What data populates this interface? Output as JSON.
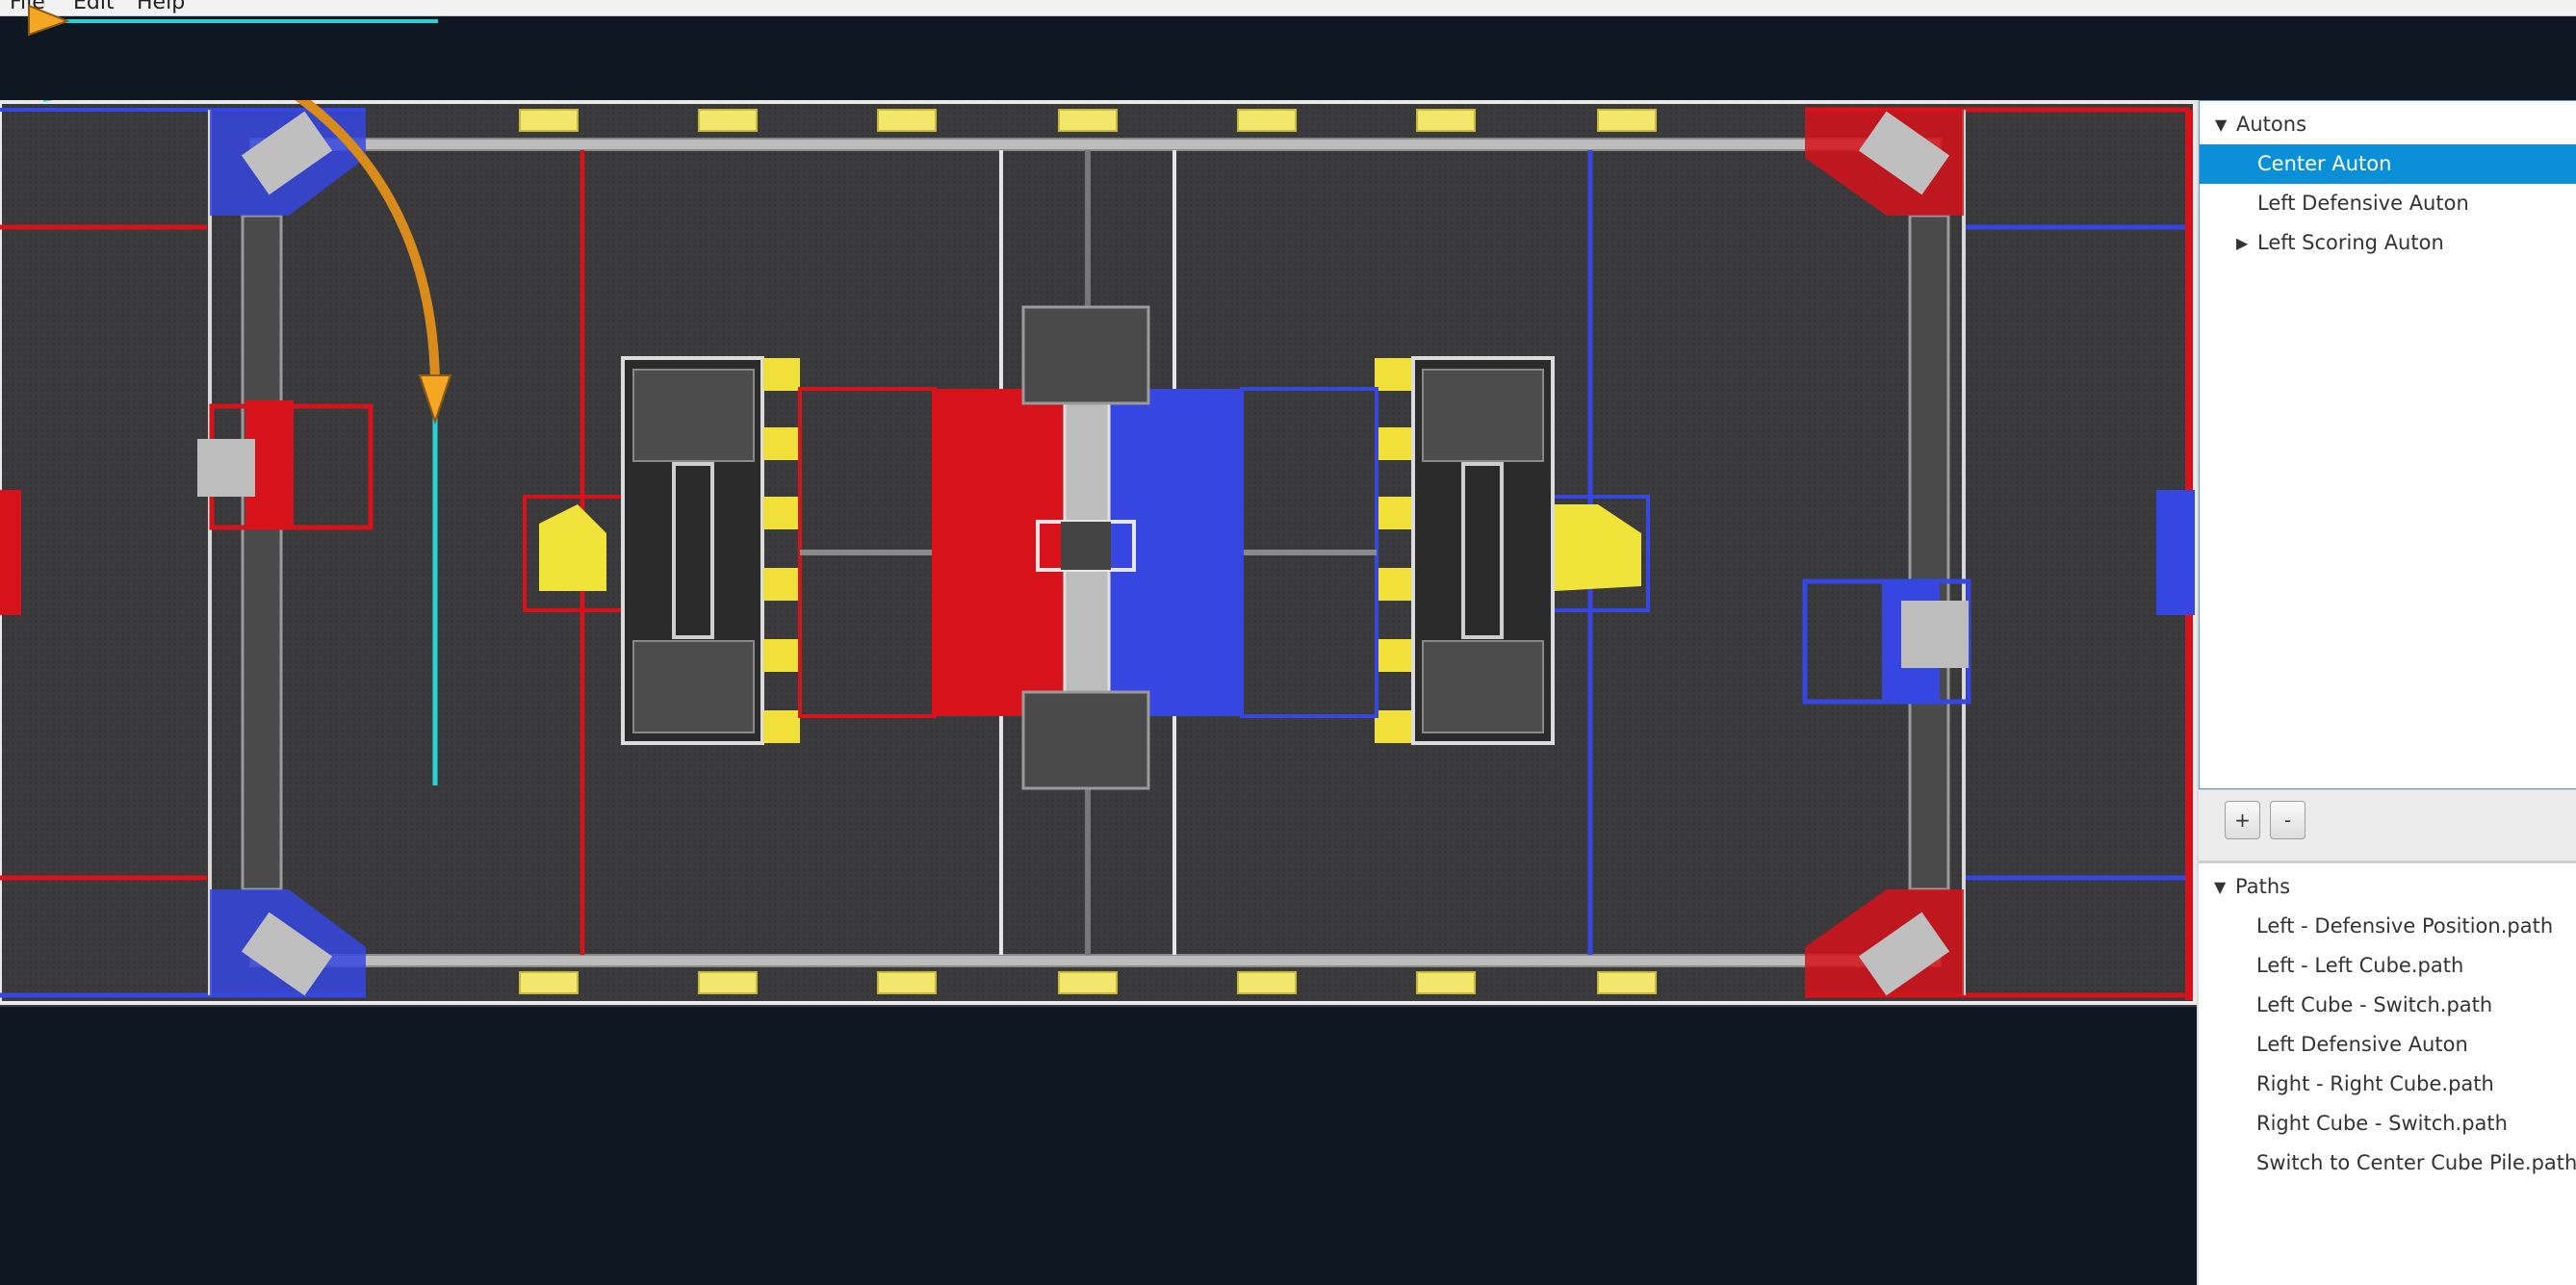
{
  "menu": {
    "file": "File",
    "edit": "Edit",
    "help": "Help"
  },
  "autons_tree": {
    "root_label": "Autons",
    "items": [
      {
        "label": "Center Auton",
        "selected": true
      },
      {
        "label": "Left Defensive Auton",
        "selected": false
      },
      {
        "label": "Left Scoring Auton",
        "selected": false,
        "collapsed": true
      }
    ]
  },
  "toolbar": {
    "add_label": "+",
    "remove_label": "-"
  },
  "paths_tree": {
    "root_label": "Paths",
    "items": [
      "Left - Defensive Position.path",
      "Left - Left Cube.path",
      "Left Cube - Switch.path",
      "Left Defensive Auton",
      "Right - Right Cube.path",
      "Right Cube - Switch.path",
      "Switch to Center Cube Pile.path"
    ]
  },
  "colors": {
    "background": "#0f1722",
    "selection": "#0b8fd6",
    "path_line": "#27d3d8",
    "path_curve": "#d98c1a",
    "waypoint_arrow": "#f5a623",
    "red_alliance": "#d7121a",
    "blue_alliance": "#3646e0"
  }
}
